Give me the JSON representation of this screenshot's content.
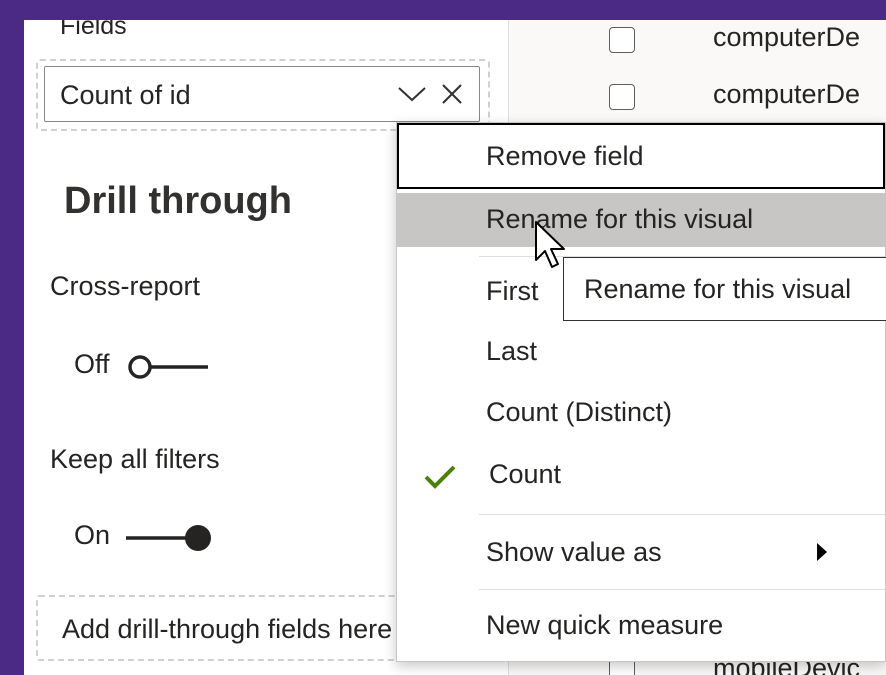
{
  "fields_panel": {
    "heading": "Fields",
    "field_pill": {
      "label": "Count of id"
    }
  },
  "drill_through": {
    "title": "Drill through",
    "cross_report": {
      "label": "Cross-report",
      "state": "Off"
    },
    "keep_all_filters": {
      "label": "Keep all filters",
      "state": "On"
    },
    "add_fields_placeholder": "Add drill-through fields here"
  },
  "field_list": {
    "items": [
      {
        "label": "computerDe",
        "checked": false
      },
      {
        "label": "computerDe",
        "checked": false
      },
      {
        "label": "mobileDevic",
        "checked": false
      }
    ]
  },
  "context_menu": {
    "items": [
      {
        "label": "Remove field",
        "state": "focused"
      },
      {
        "label": "Rename for this visual",
        "state": "hover"
      },
      {
        "label": "First"
      },
      {
        "label": "Last"
      },
      {
        "label": "Count (Distinct)"
      },
      {
        "label": "Count",
        "checked": true
      },
      {
        "label": "Show value as",
        "has_submenu": true
      },
      {
        "label": "New quick measure"
      }
    ]
  },
  "tooltip": {
    "text": "Rename for this visual"
  },
  "colors": {
    "frame_background": "#4b2a86",
    "checkmark": "#498205",
    "hover_highlight": "#c8c6c4",
    "toggle_ink": "#252423"
  },
  "icons": {
    "chevron": "chevron-down-icon",
    "close": "close-icon",
    "check": "checkmark-icon",
    "submenu": "submenu-caret-icon",
    "cursor": "mouse-pointer-icon"
  }
}
